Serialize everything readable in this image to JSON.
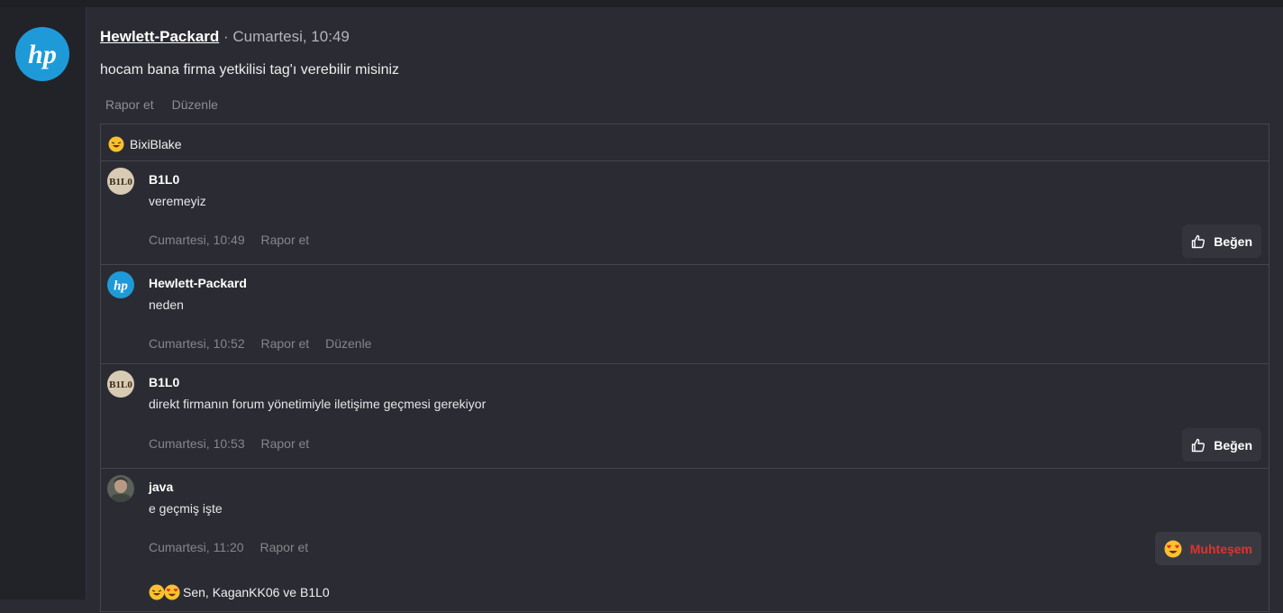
{
  "post": {
    "author": "Hewlett-Packard",
    "meta": "· Cumartesi, 10:49",
    "body": "hocam bana firma yetkilisi tag'ı verebilir misiniz",
    "actions": [
      "Rapor et",
      "Düzenle"
    ]
  },
  "reaction_summary": {
    "users": "BixiBlake",
    "emoji": "rofl-emoji"
  },
  "comments": [
    {
      "author": "B1L0",
      "avatar": "B1L0",
      "text": "veremeyiz",
      "time": "Cumartesi, 10:49",
      "actions": [
        "Rapor et"
      ],
      "button": "Beğen"
    },
    {
      "author": "Hewlett-Packard",
      "avatar": "hp-logo",
      "text": "neden",
      "time": "Cumartesi, 10:52",
      "actions": [
        "Rapor et",
        "Düzenle"
      ]
    },
    {
      "author": "B1L0",
      "avatar": "B1L0",
      "text": "direkt firmanın forum yönetimiyle iletişime geçmesi gerekiyor",
      "time": "Cumartesi, 10:53",
      "actions": [
        "Rapor et"
      ],
      "button": "Beğen"
    },
    {
      "author": "java",
      "avatar": "photo",
      "text": "e geçmiş işte",
      "time": "Cumartesi, 11:20",
      "actions": [
        "Rapor et"
      ],
      "button": "Muhteşem",
      "reactions": "Sen, KaganKK06 ve B1L0"
    }
  ],
  "colors": {
    "hp_blue": "#1e9ad8",
    "react_red": "#e0322f",
    "background": "#2b2c33"
  }
}
